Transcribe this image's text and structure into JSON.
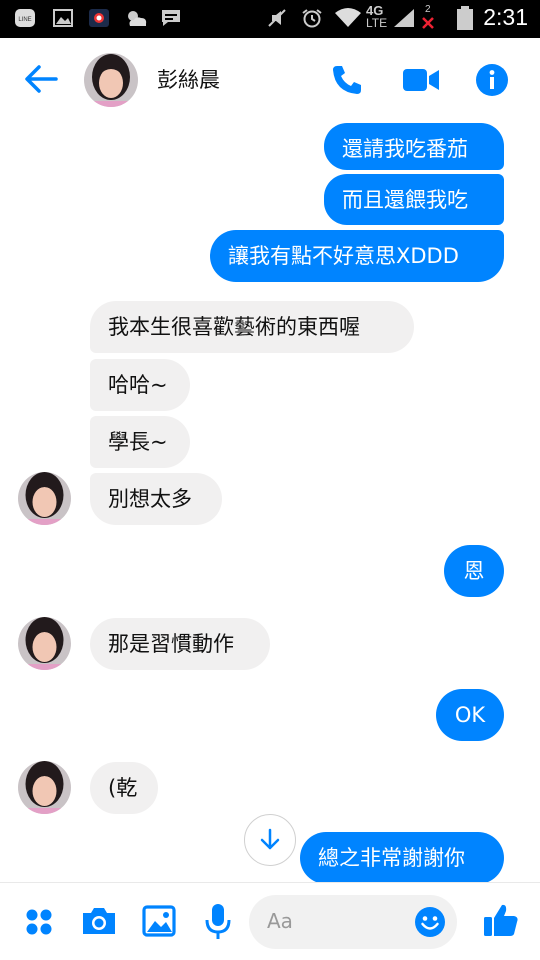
{
  "status_bar": {
    "time": "2:31",
    "network": "4G",
    "network_sub": "LTE",
    "sim_slot": "2",
    "icons": [
      "line-icon",
      "image-icon",
      "app-icon",
      "weather-icon",
      "message-icon",
      "mute-icon",
      "alarm-icon",
      "wifi-icon",
      "signal-icon",
      "battery-icon"
    ]
  },
  "header": {
    "contact_name": "彭絲晨",
    "icons": [
      "back-arrow-icon",
      "phone-icon",
      "video-icon",
      "info-icon"
    ]
  },
  "messages": [
    {
      "side": "out",
      "text": "還請我吃番茄"
    },
    {
      "side": "out",
      "text": "而且還餵我吃"
    },
    {
      "side": "out",
      "text": "讓我有點不好意思XDDD"
    },
    {
      "side": "in",
      "text": "我本生很喜歡藝術的東西喔"
    },
    {
      "side": "in",
      "text": "哈哈~"
    },
    {
      "side": "in",
      "text": "學長~"
    },
    {
      "side": "in",
      "text": "別想太多"
    },
    {
      "side": "out",
      "text": "恩"
    },
    {
      "side": "in",
      "text": "那是習慣動作"
    },
    {
      "side": "out",
      "text": "OK"
    },
    {
      "side": "in",
      "text": "(乾"
    },
    {
      "side": "out",
      "text": "總之非常謝謝你"
    }
  ],
  "composer": {
    "placeholder": "Aa",
    "icons": [
      "apps-icon",
      "camera-icon",
      "gallery-icon",
      "microphone-icon",
      "emoji-icon",
      "like-icon"
    ]
  },
  "colors": {
    "accent": "#0084ff",
    "incoming_bubble": "#f1f0f0",
    "outgoing_text": "#ffffff",
    "status_bar": "#000000"
  }
}
